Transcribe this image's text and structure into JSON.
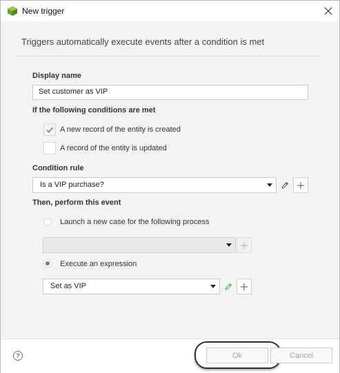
{
  "window": {
    "title": "New trigger",
    "icon": "green-cube-icon",
    "close_icon": "close-icon"
  },
  "description": "Triggers automatically execute events after a condition is met",
  "display_name": {
    "label": "Display name",
    "value": "Set customer as VIP"
  },
  "conditions": {
    "label": "If the following conditions are met",
    "options": [
      {
        "label": "A new record of the entity is created",
        "checked": true
      },
      {
        "label": "A record of the entity is updated",
        "checked": false
      }
    ]
  },
  "condition_rule": {
    "label": "Condition rule",
    "selected": "Is a VIP purchase?"
  },
  "event": {
    "label": "Then, perform this event",
    "process_option": {
      "label": "Launch a new case for the following process",
      "selected": false,
      "value": ""
    },
    "expression_option": {
      "label": "Execute an expression",
      "selected": true,
      "value": "Set as VIP"
    }
  },
  "footer": {
    "ok_label": "Ok",
    "cancel_label": "Cancel",
    "help_icon": "help-icon"
  },
  "colors": {
    "accent_green": "#4caf50",
    "help_blue": "#4a7fc1",
    "dialog_bg": "#f3f3f3"
  }
}
